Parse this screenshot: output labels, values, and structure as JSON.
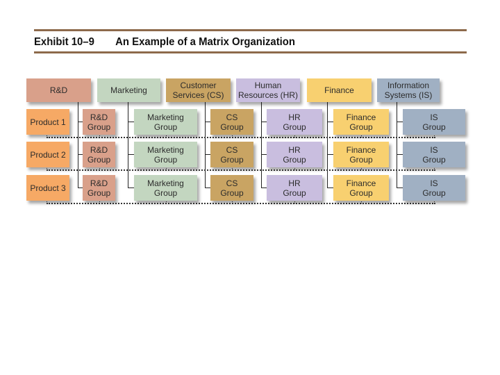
{
  "exhibit": {
    "number": "Exhibit 10–9",
    "title": "An Example of a Matrix Organization"
  },
  "colors": {
    "rule": "#8d6a4b",
    "rd": "#d9a08a",
    "marketing": "#c3d6c0",
    "cs": "#c9a463",
    "hr": "#c9bedf",
    "finance": "#f8d070",
    "is": "#a0b0c3",
    "product": "#f6a965"
  },
  "functions": [
    {
      "key": "rd",
      "label": "R&D",
      "group_line1": "R&D",
      "group_line2": "Group"
    },
    {
      "key": "marketing",
      "label": "Marketing",
      "group_line1": "Marketing",
      "group_line2": "Group"
    },
    {
      "key": "cs",
      "label_line1": "Customer",
      "label_line2": "Services (CS)",
      "group_line1": "CS",
      "group_line2": "Group"
    },
    {
      "key": "hr",
      "label_line1": "Human",
      "label_line2": "Resources (HR)",
      "group_line1": "HR",
      "group_line2": "Group"
    },
    {
      "key": "finance",
      "label": "Finance",
      "group_line1": "Finance",
      "group_line2": "Group"
    },
    {
      "key": "is",
      "label_line1": "Information",
      "label_line2": "Systems (IS)",
      "group_line1": "IS",
      "group_line2": "Group"
    }
  ],
  "products": [
    {
      "label": "Product 1"
    },
    {
      "label": "Product 2"
    },
    {
      "label": "Product 3"
    }
  ]
}
